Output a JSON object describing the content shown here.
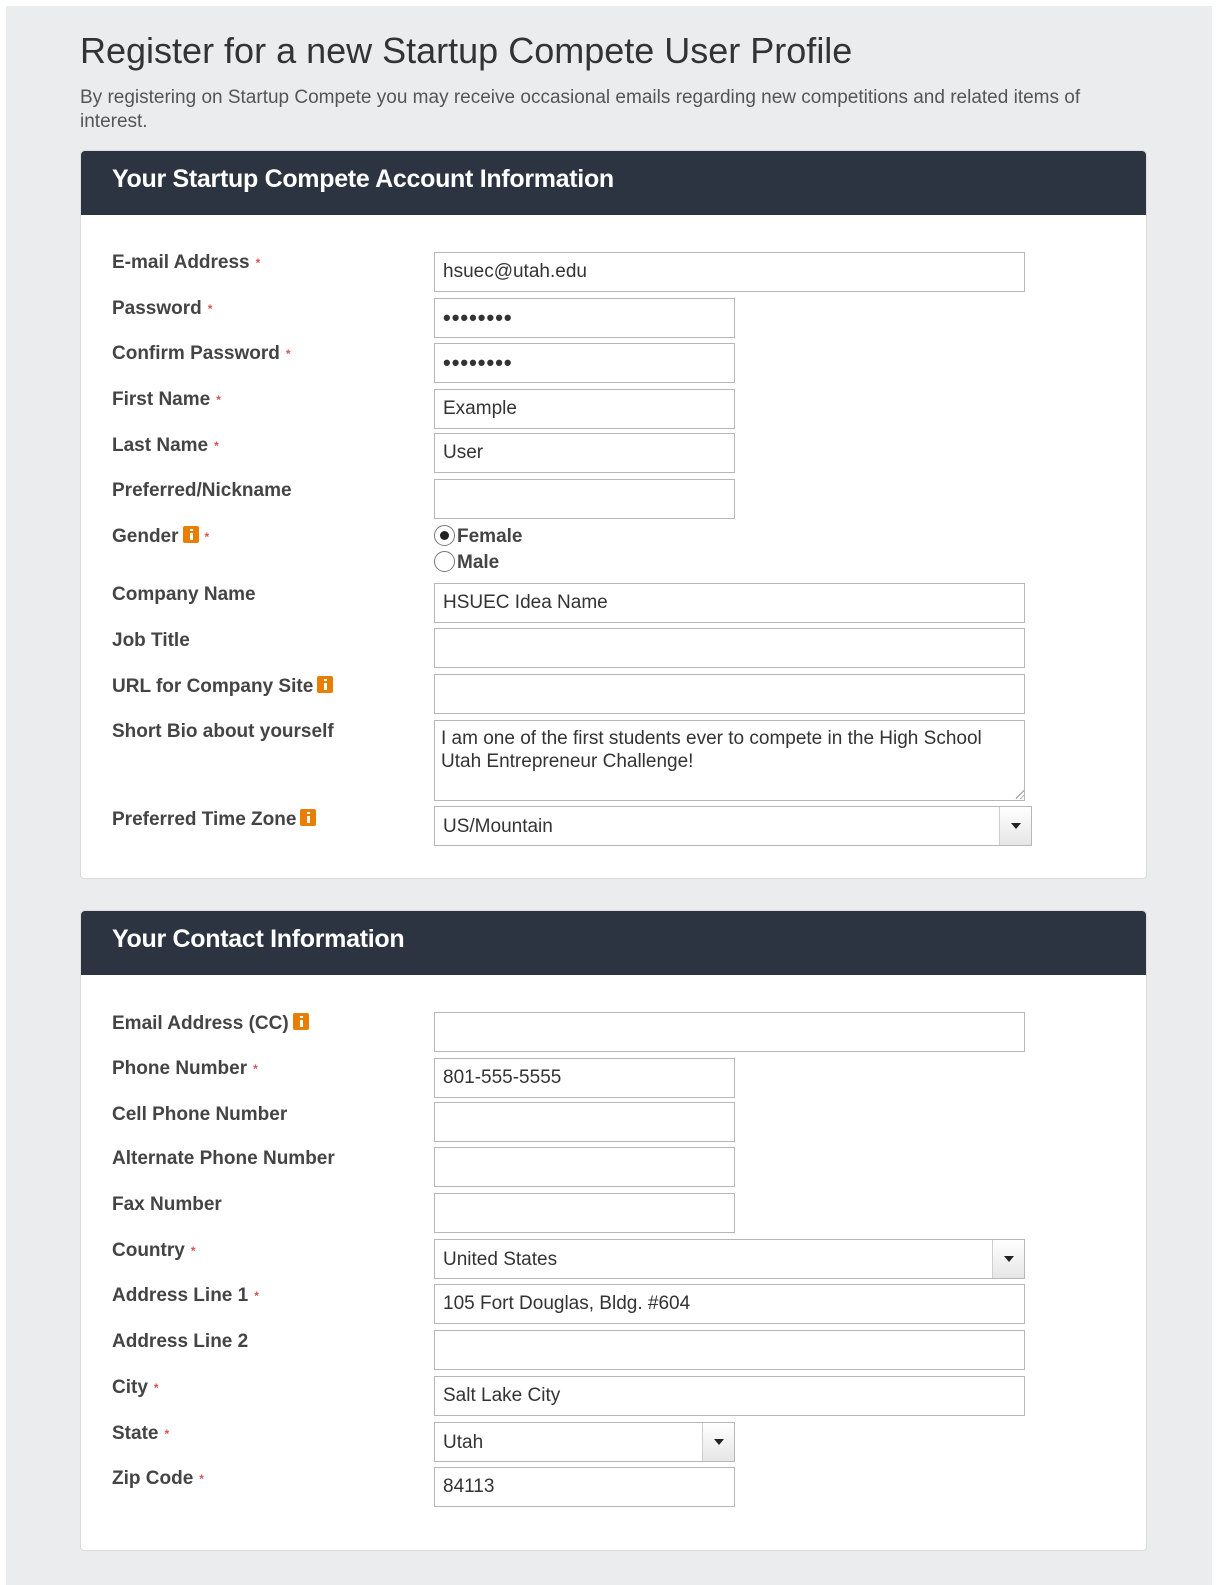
{
  "page": {
    "title": "Register for a new Startup Compete User Profile",
    "intro": "By registering on Startup Compete you may receive occasional emails regarding new competitions and related items of interest."
  },
  "account": {
    "heading": "Your Startup Compete Account Information",
    "email": {
      "label": "E-mail Address",
      "value": "hsuec@utah.edu"
    },
    "password": {
      "label": "Password",
      "value": "••••••••"
    },
    "confirm_password": {
      "label": "Confirm Password",
      "value": "••••••••"
    },
    "first_name": {
      "label": "First Name",
      "value": "Example"
    },
    "last_name": {
      "label": "Last Name",
      "value": "User"
    },
    "nickname": {
      "label": "Preferred/Nickname",
      "value": ""
    },
    "gender": {
      "label": "Gender",
      "options": [
        "Female",
        "Male"
      ],
      "selected": "Female"
    },
    "company_name": {
      "label": "Company Name",
      "value": "HSUEC Idea Name"
    },
    "job_title": {
      "label": "Job Title",
      "value": ""
    },
    "company_url": {
      "label": "URL for Company Site",
      "value": ""
    },
    "bio": {
      "label": "Short Bio about yourself",
      "value": "I am one of the first students ever to compete in the High School Utah Entrepreneur Challenge!"
    },
    "time_zone": {
      "label": "Preferred Time Zone",
      "value": "US/Mountain"
    }
  },
  "contact": {
    "heading": "Your Contact Information",
    "cc_email": {
      "label": "Email Address (CC)",
      "value": ""
    },
    "phone": {
      "label": "Phone Number",
      "value": "801-555-5555"
    },
    "cell_phone": {
      "label": "Cell Phone Number",
      "value": ""
    },
    "alt_phone": {
      "label": "Alternate Phone Number",
      "value": ""
    },
    "fax": {
      "label": "Fax Number",
      "value": ""
    },
    "country": {
      "label": "Country",
      "value": "United States"
    },
    "address1": {
      "label": "Address Line 1",
      "value": "105 Fort Douglas, Bldg. #604"
    },
    "address2": {
      "label": "Address Line 2",
      "value": ""
    },
    "city": {
      "label": "City",
      "value": "Salt Lake City"
    },
    "state": {
      "label": "State",
      "value": "Utah"
    },
    "zip": {
      "label": "Zip Code",
      "value": "84113"
    }
  },
  "required_marker": "*",
  "colors": {
    "header_bg": "#2b3440",
    "required": "#d9534f",
    "info_icon": "#e87e04",
    "page_bg": "#ebeced"
  }
}
